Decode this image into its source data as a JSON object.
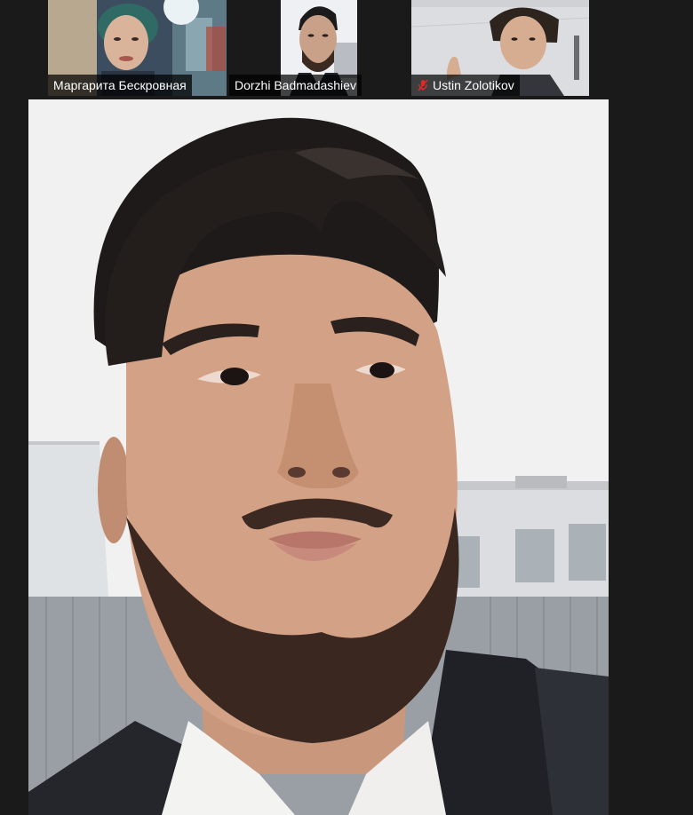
{
  "participants": [
    {
      "name": "Маргарита Бескровная",
      "muted": false,
      "tile_bg": "#3a4a5a"
    },
    {
      "name": "Dorzhi Badmadashiev",
      "muted": false,
      "tile_bg": "#dde3ea"
    },
    {
      "name": "Ustin Zolotikov",
      "muted": true,
      "tile_bg": "#d9dadc"
    }
  ],
  "main_speaker": {
    "name": "Dorzhi Badmadashiev"
  },
  "colors": {
    "app_bg": "#1a1a1a",
    "name_tag_bg": "#000000",
    "name_tag_text": "#ffffff",
    "muted_icon": "#e02828"
  }
}
